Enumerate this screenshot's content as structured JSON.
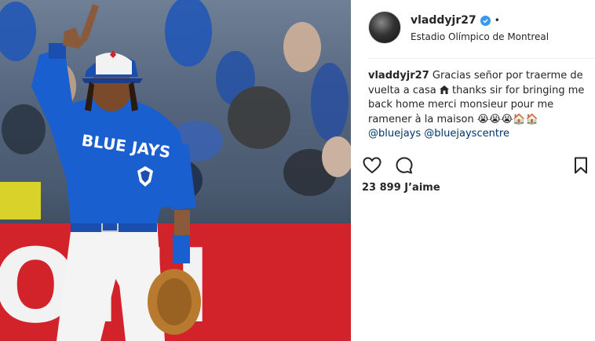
{
  "post": {
    "username": "vladdyjr27",
    "separator": "•",
    "location": "Estadio Olímpico de Montreal",
    "caption": {
      "user": "vladdyjr27",
      "text_part1": "Gracias señor por traerme de vuelta a casa",
      "text_part2": "thanks sir for bringing me back home merci monsieur pour me ramener à la maison",
      "emojis": "😭😭😭🏠🏠",
      "mention1": "@bluejays",
      "mention2": "@bluejayscentre"
    },
    "likes_text": "23 899 J’aime"
  },
  "photo": {
    "jersey_text": "BLUE JAYS",
    "banner_text": "ONI"
  },
  "icons": {
    "verified": "verified-badge-icon",
    "house": "house-icon",
    "like": "heart-icon",
    "comment": "comment-icon",
    "save": "bookmark-icon"
  },
  "colors": {
    "accent_blue": "#3897f0",
    "mention_blue": "#003569",
    "jersey_blue": "#1a5fd0",
    "banner_red": "#d3232a"
  }
}
